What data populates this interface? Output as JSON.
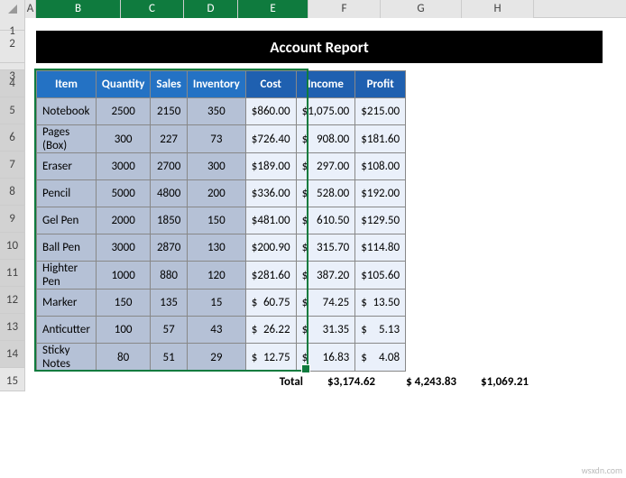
{
  "columns": [
    "A",
    "B",
    "C",
    "D",
    "E",
    "F",
    "G",
    "H"
  ],
  "rows": [
    "1",
    "2",
    "3",
    "4",
    "5",
    "6",
    "7",
    "8",
    "9",
    "10",
    "11",
    "12",
    "13",
    "14",
    "15"
  ],
  "title": "Account Report",
  "headers1": {
    "item": "Item",
    "quantity": "Quantity",
    "sales": "Sales",
    "inventory": "Inventory"
  },
  "headers2": {
    "cost": "Cost",
    "income": "Income",
    "profit": "Profit"
  },
  "data": [
    {
      "item": "Notebook",
      "quantity": "2500",
      "sales": "2150",
      "inventory": "350",
      "cost": "860.00",
      "income": "1,075.00",
      "profit": "215.00"
    },
    {
      "item": "Pages (Box)",
      "quantity": "300",
      "sales": "227",
      "inventory": "73",
      "cost": "726.40",
      "income": "908.00",
      "profit": "181.60"
    },
    {
      "item": "Eraser",
      "quantity": "3000",
      "sales": "2700",
      "inventory": "300",
      "cost": "189.00",
      "income": "297.00",
      "profit": "108.00"
    },
    {
      "item": "Pencil",
      "quantity": "5000",
      "sales": "4800",
      "inventory": "200",
      "cost": "336.00",
      "income": "528.00",
      "profit": "192.00"
    },
    {
      "item": "Gel Pen",
      "quantity": "2000",
      "sales": "1850",
      "inventory": "150",
      "cost": "481.00",
      "income": "610.50",
      "profit": "129.50"
    },
    {
      "item": "Ball Pen",
      "quantity": "3000",
      "sales": "2870",
      "inventory": "130",
      "cost": "200.90",
      "income": "315.70",
      "profit": "114.80"
    },
    {
      "item": "Highter Pen",
      "quantity": "1000",
      "sales": "880",
      "inventory": "120",
      "cost": "281.60",
      "income": "387.20",
      "profit": "105.60"
    },
    {
      "item": "Marker",
      "quantity": "150",
      "sales": "135",
      "inventory": "15",
      "cost": "60.75",
      "income": "74.25",
      "profit": "13.50"
    },
    {
      "item": "Anticutter",
      "quantity": "100",
      "sales": "57",
      "inventory": "43",
      "cost": "26.22",
      "income": "31.35",
      "profit": "5.13"
    },
    {
      "item": "Sticky Notes",
      "quantity": "80",
      "sales": "51",
      "inventory": "29",
      "cost": "12.75",
      "income": "16.83",
      "profit": "4.08"
    }
  ],
  "totals": {
    "label": "Total",
    "cost": "$3,174.62",
    "income": "$ 4,243.83",
    "profit": "$1,069.21"
  },
  "currency": "$",
  "watermark": "wsxdn.com"
}
